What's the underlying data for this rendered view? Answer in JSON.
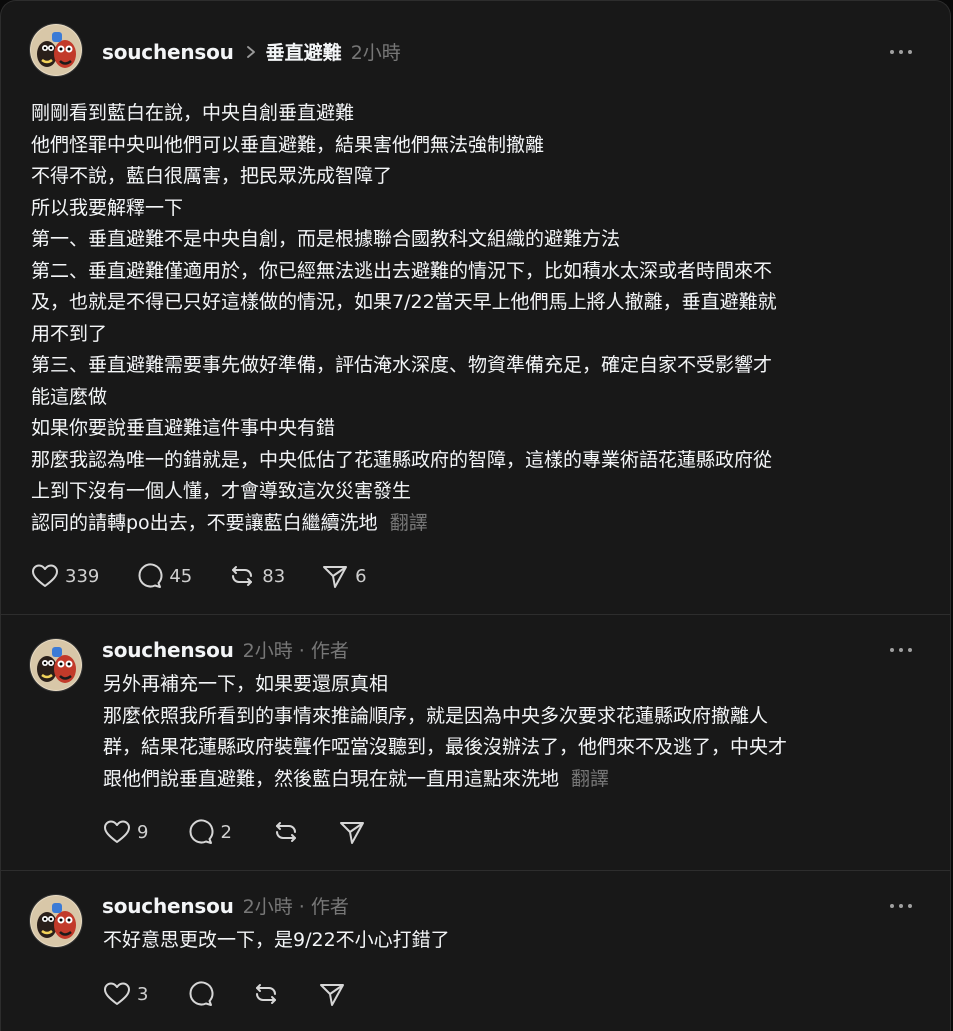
{
  "main_post": {
    "username": "souchensou",
    "topic": "垂直避難",
    "time": "2小時",
    "lines": [
      "剛剛看到藍白在說，中央自創垂直避難",
      "他們怪罪中央叫他們可以垂直避難，結果害他們無法強制撤離",
      "不得不說，藍白很厲害，把民眾洗成智障了",
      "所以我要解釋一下",
      "第一、垂直避難不是中央自創，而是根據聯合國教科文組織的避難方法",
      "第二、垂直避難僅適用於，你已經無法逃出去避難的情況下，比如積水太深或者時間來不",
      "及，也就是不得已只好這樣做的情況，如果7/22當天早上他們馬上將人撤離，垂直避難就",
      "用不到了",
      "第三、垂直避難需要事先做好準備，評估淹水深度、物資準備充足，確定自家不受影響才",
      "能這麼做",
      "如果你要說垂直避難這件事中央有錯",
      "那麼我認為唯一的錯就是，中央低估了花蓮縣政府的智障，這樣的專業術語花蓮縣政府從",
      "上到下沒有一個人懂，才會導致這次災害發生",
      "認同的請轉po出去，不要讓藍白繼續洗地"
    ],
    "translate_label": "翻譯",
    "likes": "339",
    "comments": "45",
    "reposts": "83",
    "shares": "6"
  },
  "replies": [
    {
      "username": "souchensou",
      "meta": "2小時 · 作者",
      "lines": [
        "另外再補充一下，如果要還原真相",
        "那麼依照我所看到的事情來推論順序，就是因為中央多次要求花蓮縣政府撤離人",
        "群，結果花蓮縣政府裝聾作啞當沒聽到，最後沒辦法了，他們來不及逃了，中央才",
        "跟他們說垂直避難，然後藍白現在就一直用這點來洗地"
      ],
      "translate_label": "翻譯",
      "likes": "9",
      "comments": "2"
    },
    {
      "username": "souchensou",
      "meta": "2小時 · 作者",
      "lines": [
        "不好意思更改一下，是9/22不小心打錯了"
      ],
      "likes": "3"
    }
  ],
  "icons": {
    "like": "heart-icon",
    "comment": "comment-bubble-icon",
    "repost": "repost-icon",
    "share": "send-icon",
    "more": "more-dots-icon",
    "chevron": "chevron-right-icon"
  },
  "colors": {
    "background": "#181818",
    "text": "#f3f5f7",
    "muted": "#777777",
    "divider": "#2d2d2d"
  }
}
